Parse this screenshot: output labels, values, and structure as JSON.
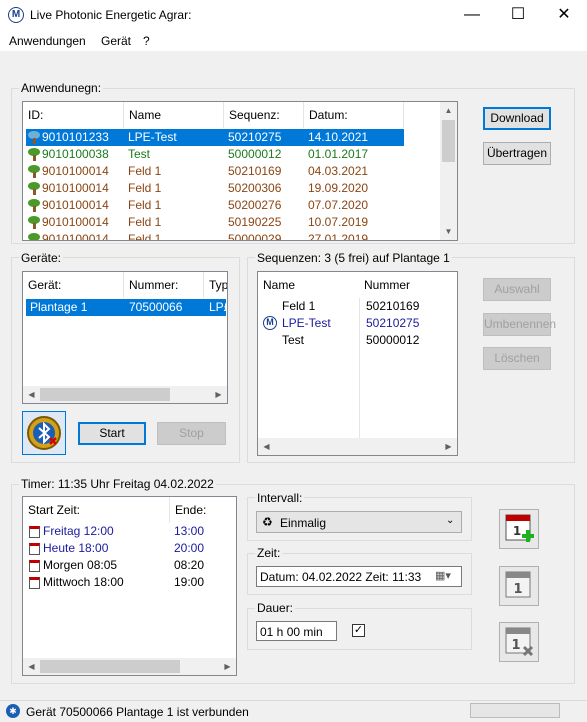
{
  "window": {
    "title": "Live Photonic Energetic Agrar:",
    "app_icon_glyph": "M"
  },
  "menu": [
    "Anwendungen",
    "Gerät",
    "?"
  ],
  "anwendungen": {
    "label": "Anwendunegn:",
    "columns": [
      "ID:",
      "Name",
      "Sequenz:",
      "Datum:"
    ],
    "rows": [
      {
        "id": "9010101233",
        "name": "LPE-Test",
        "seq": "50210275",
        "date": "14.10.2021",
        "selected": true,
        "color": "#ffffff"
      },
      {
        "id": "9010100038",
        "name": "Test",
        "seq": "50000012",
        "date": "01.01.2017",
        "color": "#1c7a1c"
      },
      {
        "id": "9010100014",
        "name": "Feld 1",
        "seq": "50210169",
        "date": "04.03.2021",
        "color": "#8b4513"
      },
      {
        "id": "9010100014",
        "name": "Feld 1",
        "seq": "50200306",
        "date": "19.09.2020",
        "color": "#8b4513"
      },
      {
        "id": "9010100014",
        "name": "Feld 1",
        "seq": "50200276",
        "date": "07.07.2020",
        "color": "#8b4513"
      },
      {
        "id": "9010100014",
        "name": "Feld 1",
        "seq": "50190225",
        "date": "10.07.2019",
        "color": "#8b4513"
      },
      {
        "id": "9010100014",
        "name": "Feld 1",
        "seq": "50000029",
        "date": "27.01.2019",
        "color": "#8b4513"
      }
    ],
    "download_label": "Download",
    "uebertragen_label": "Übertragen"
  },
  "geraete": {
    "label": "Geräte:",
    "columns": [
      "Gerät:",
      "Nummer:",
      "Typ"
    ],
    "rows": [
      {
        "name": "Plantage 1",
        "number": "70500066",
        "type": "LP£"
      }
    ],
    "start_label": "Start",
    "stop_label": "Stop"
  },
  "sequenzen": {
    "label": "Sequenzen: 3 (5 frei) auf Plantage 1",
    "columns": [
      "Name",
      "Nummer"
    ],
    "rows": [
      {
        "name": "Feld 1",
        "number": "50210169",
        "active": false
      },
      {
        "name": "LPE-Test",
        "number": "50210275",
        "active": true
      },
      {
        "name": "Test",
        "number": "50000012",
        "active": false
      }
    ],
    "auswahl_label": "Auswahl",
    "umbenennen_label": "Umbenennen",
    "loeschen_label": "Löschen"
  },
  "timer": {
    "label": "Timer:  11:35 Uhr  Freitag 04.02.2022",
    "columns": [
      "Start Zeit:",
      "Ende:"
    ],
    "rows": [
      {
        "start": "Freitag 12:00",
        "end": "13:00",
        "color": "#1a1aa0"
      },
      {
        "start": "Heute 18:00",
        "end": "20:00",
        "color": "#1a1aa0"
      },
      {
        "start": "Morgen 08:05",
        "end": "08:20",
        "color": "#000000"
      },
      {
        "start": "Mittwoch 18:00",
        "end": "19:00",
        "color": "#000000"
      }
    ],
    "intervall_label": "Intervall:",
    "intervall_value": "Einmalig",
    "zeit_label": "Zeit:",
    "zeit_value": "Datum: 04.02.2022 Zeit: 11:33",
    "dauer_label": "Dauer:",
    "dauer_value": "01 h 00 min",
    "dauer_checked": true,
    "cal_icon_1": "1",
    "cal_icon_2": "1",
    "cal_icon_3": "1"
  },
  "status": {
    "text": "Gerät 70500066 Plantage 1 ist verbunden"
  },
  "colors": {
    "accent": "#0078d7",
    "active_blue": "#1a1aa0"
  }
}
